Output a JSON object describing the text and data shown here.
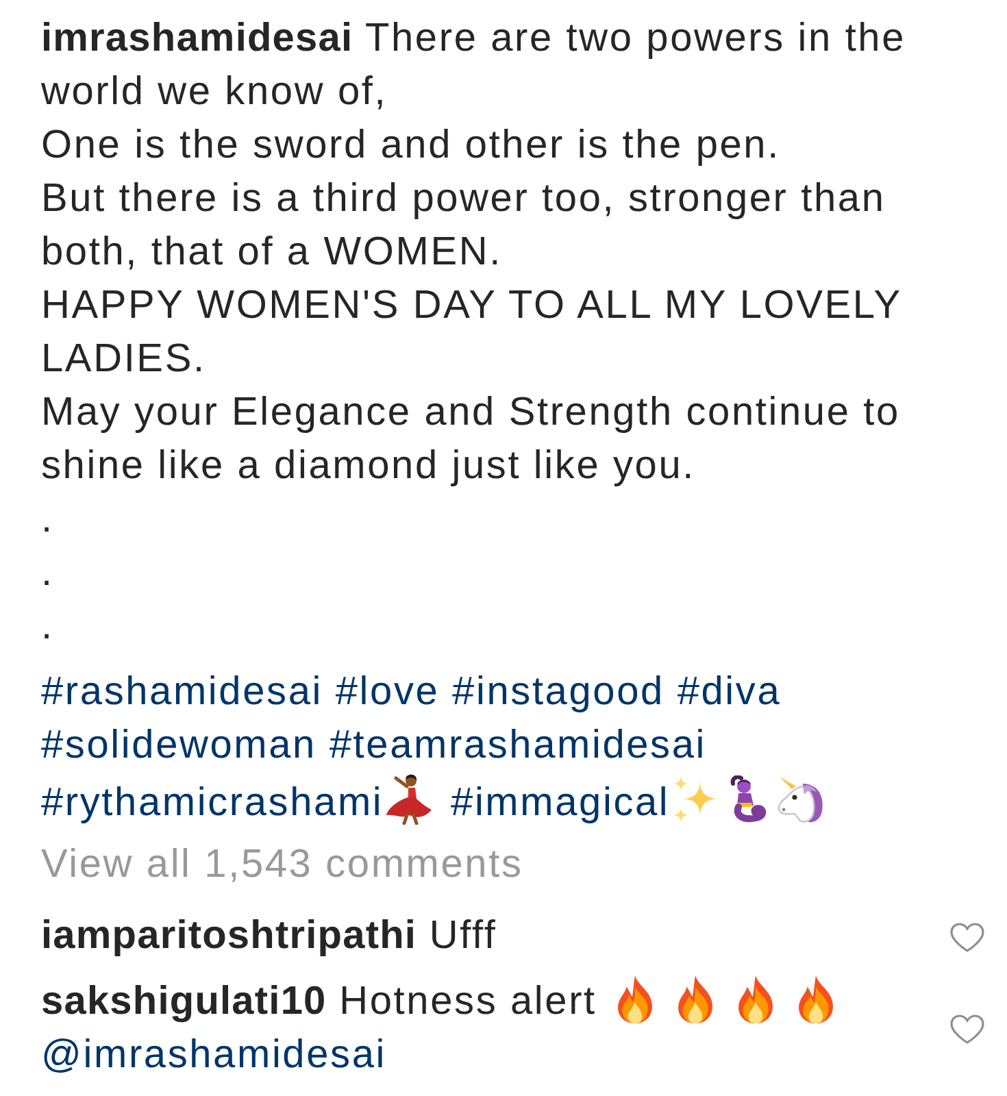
{
  "caption": {
    "username": "imrashamidesai",
    "paragraphs": [
      "There are two powers in the world we know of,",
      "One is the sword and other is the pen.",
      "But there is a third power too, stronger than both, that of a WOMEN.",
      "HAPPY WOMEN'S DAY TO ALL MY LOVELY LADIES.",
      "May your Elegance and Strength continue to shine like a diamond just like you.",
      ".",
      ".",
      "."
    ],
    "tags": [
      {
        "kind": "hashtag",
        "text": "#rashamidesai"
      },
      {
        "kind": "hashtag",
        "text": "#love"
      },
      {
        "kind": "hashtag",
        "text": "#instagood"
      },
      {
        "kind": "hashtag",
        "text": "#diva"
      },
      {
        "kind": "hashtag",
        "text": "#solidewoman"
      },
      {
        "kind": "hashtag",
        "text": "#teamrashamidesai"
      },
      {
        "kind": "hashtag",
        "text": "#rythamicrashami"
      },
      {
        "kind": "dancer"
      },
      {
        "kind": "hashtag",
        "text": "#immagical"
      },
      {
        "kind": "sparkles"
      },
      {
        "kind": "genie"
      },
      {
        "kind": "unicorn"
      }
    ]
  },
  "view_all": "View all 1,543 comments",
  "comments": [
    {
      "username": "iamparitoshtripathi",
      "liked": false,
      "parts": [
        {
          "kind": "text",
          "text": "Ufff"
        }
      ]
    },
    {
      "username": "sakshigulati10",
      "liked": false,
      "parts": [
        {
          "kind": "text",
          "text": "Hotness alert"
        },
        {
          "kind": "fire"
        },
        {
          "kind": "fire"
        },
        {
          "kind": "fire"
        },
        {
          "kind": "fire"
        },
        {
          "kind": "mention",
          "text": "@imrashamidesai"
        }
      ]
    }
  ]
}
